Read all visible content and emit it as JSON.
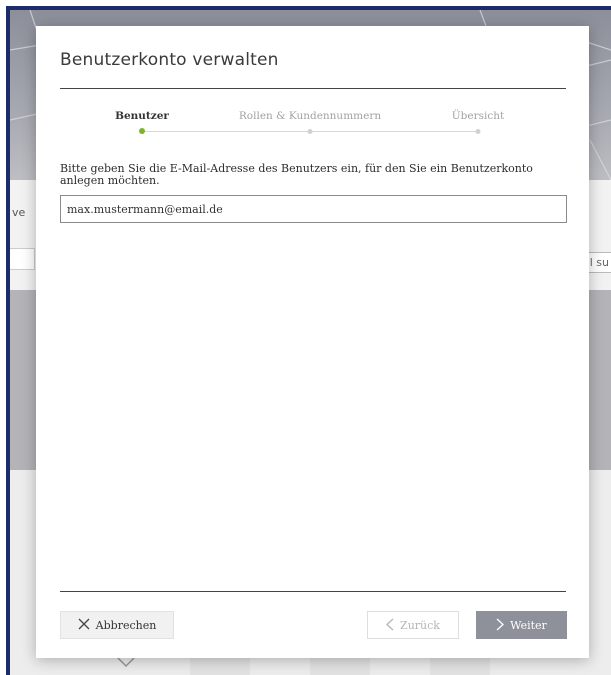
{
  "dialog": {
    "title": "Benutzerkonto verwalten",
    "steps": [
      {
        "label": "Benutzer",
        "active": true
      },
      {
        "label": "Rollen & Kundennummern",
        "active": false
      },
      {
        "label": "Übersicht",
        "active": false
      }
    ],
    "instruction": "Bitte geben Sie die E-Mail-Adresse des Benutzers ein, für den Sie ein Benutzerkonto anlegen möchten.",
    "email_value": "max.mustermann@email.de",
    "buttons": {
      "cancel": "Abbrechen",
      "back": "Zurück",
      "next": "Weiter"
    },
    "icons": {
      "cancel": "close-icon",
      "back": "chevron-left-icon",
      "next": "chevron-right-icon"
    }
  },
  "background": {
    "left_fragment": "ve",
    "right_fragment": "l su"
  },
  "colors": {
    "accent_green": "#7bb52a",
    "next_button": "#8e9199",
    "frame_blue": "#1c2c6a"
  }
}
